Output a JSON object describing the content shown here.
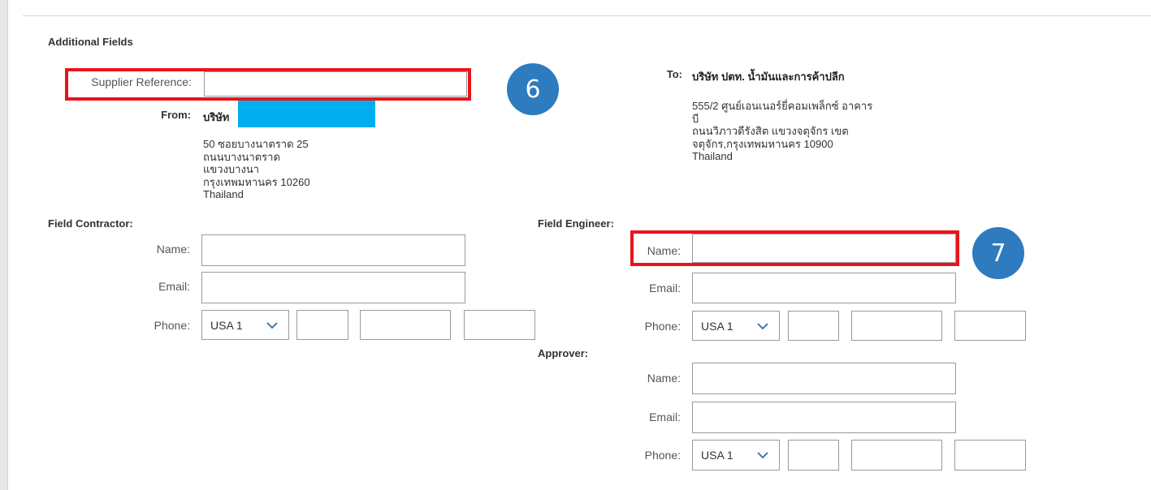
{
  "section_title": "Additional Fields",
  "supplier_reference": {
    "label": "Supplier Reference:",
    "value": ""
  },
  "badges": {
    "six": "6",
    "seven": "7"
  },
  "from": {
    "label": "From:",
    "name": "บริษัท",
    "address": "50 ซอยบางนาตราด 25\nถนนบางนาตราด\nแขวงบางนา\nกรุงเทพมหานคร 10260\nThailand"
  },
  "to": {
    "label": "To:",
    "name": "บริษัท ปตท. น้ำมันและการค้าปลีก",
    "address": "555/2 ศูนย์เอนเนอร์ยี่คอมเพล็กซ์ อาคาร\nบี\nถนนวิภาวดีรังสิต แขวงจตุจักร เขต\nจตุจักร,กรุงเทพมหานคร 10900\nThailand"
  },
  "field_contractor": {
    "heading": "Field Contractor:",
    "name_label": "Name:",
    "email_label": "Email:",
    "phone_label": "Phone:",
    "country": "USA 1"
  },
  "field_engineer": {
    "heading": "Field Engineer:",
    "name_label": "Name:",
    "email_label": "Email:",
    "phone_label": "Phone:",
    "country": "USA 1"
  },
  "approver": {
    "heading": "Approver:",
    "name_label": "Name:",
    "email_label": "Email:",
    "phone_label": "Phone:",
    "country": "USA 1"
  },
  "colors": {
    "highlight": "#e8141b",
    "badge": "#2e7bbf",
    "redaction": "#00aeef"
  }
}
